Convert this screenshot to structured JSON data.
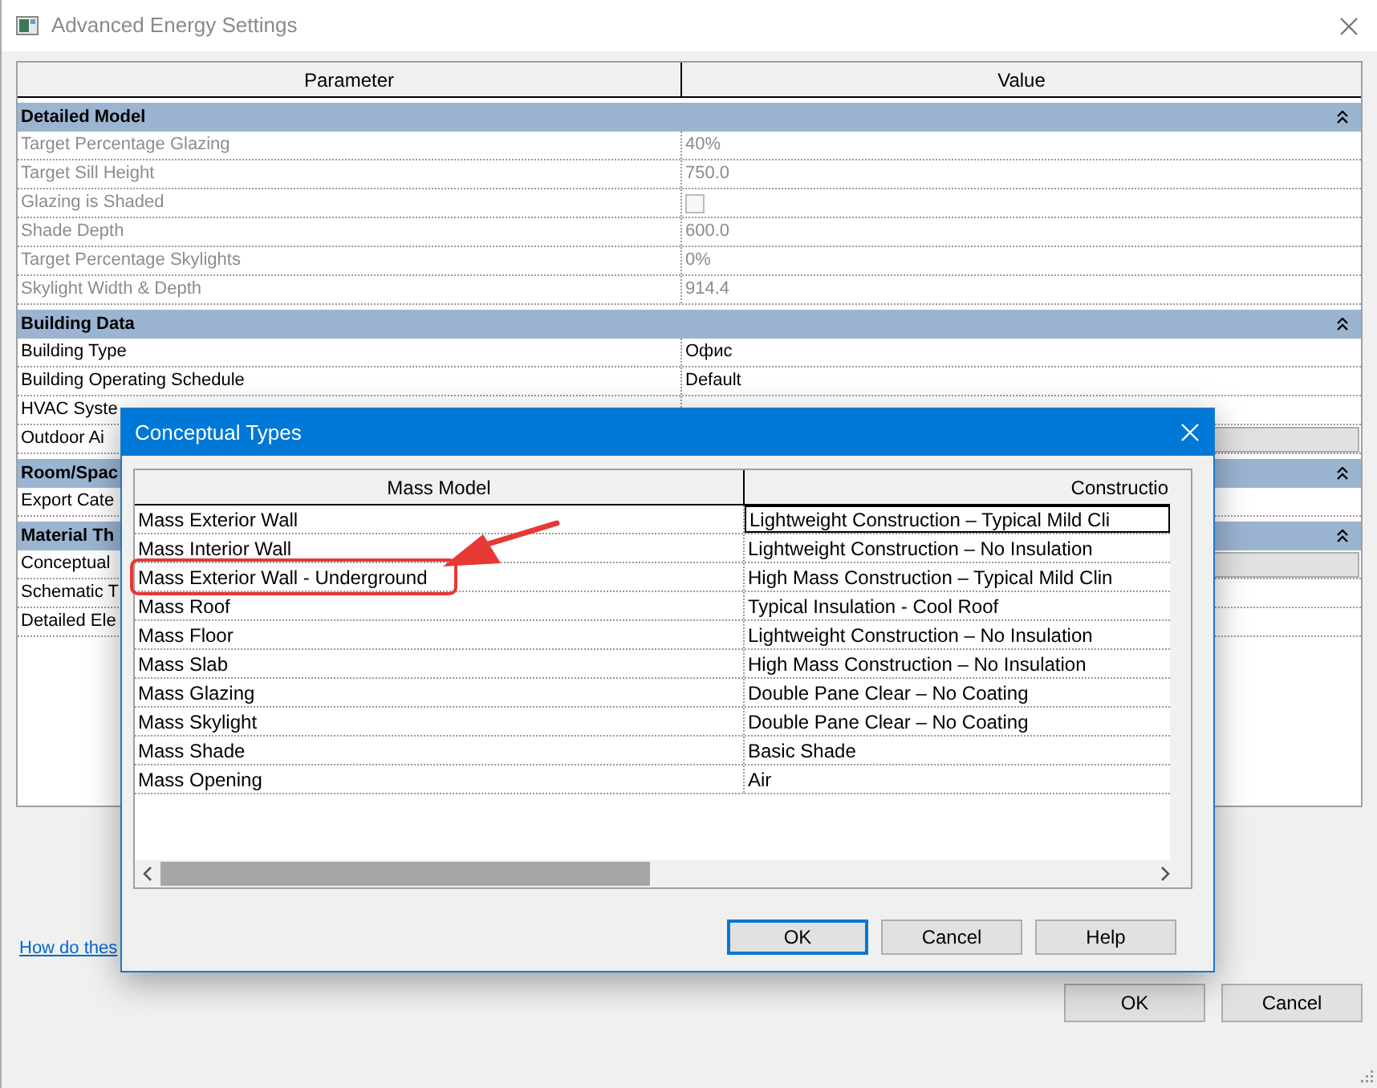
{
  "window": {
    "title": "Advanced Energy Settings"
  },
  "grid": {
    "columns": [
      "Parameter",
      "Value"
    ],
    "sections": [
      {
        "title": "Detailed Model",
        "expanded": true,
        "rows": [
          {
            "label": "Target Percentage Glazing",
            "kind": "text",
            "value": "40%",
            "disabled": true
          },
          {
            "label": "Target Sill Height",
            "kind": "text",
            "value": "750.0",
            "disabled": true
          },
          {
            "label": "Glazing is Shaded",
            "kind": "checkbox",
            "checked": false,
            "disabled": true
          },
          {
            "label": "Shade Depth",
            "kind": "text",
            "value": "600.0",
            "disabled": true
          },
          {
            "label": "Target Percentage Skylights",
            "kind": "text",
            "value": "0%",
            "disabled": true
          },
          {
            "label": "Skylight Width & Depth",
            "kind": "text",
            "value": "914.4",
            "disabled": true
          }
        ]
      },
      {
        "title": "Building Data",
        "expanded": true,
        "rows": [
          {
            "label": "Building Type",
            "kind": "text",
            "value": "Офис",
            "disabled": false
          },
          {
            "label": "Building Operating Schedule",
            "kind": "text",
            "value": "Default",
            "disabled": false
          },
          {
            "label": "HVAC Syste",
            "kind": "empty",
            "disabled": false
          },
          {
            "label": "Outdoor Ai",
            "kind": "dropdown",
            "disabled": false
          }
        ]
      },
      {
        "title": "Room/Spac",
        "expanded": true,
        "rows": [
          {
            "label": "Export Cate",
            "kind": "empty",
            "disabled": false
          }
        ]
      },
      {
        "title": "Material Th",
        "expanded": true,
        "rows": [
          {
            "label": "Conceptual",
            "kind": "dropdown",
            "disabled": false
          },
          {
            "label": "Schematic T",
            "kind": "empty",
            "disabled": false
          },
          {
            "label": "Detailed Ele",
            "kind": "empty",
            "disabled": false
          }
        ]
      }
    ]
  },
  "help_link": "How do thes",
  "buttons": [
    "OK",
    "Cancel"
  ],
  "dialog": {
    "title": "Conceptual Types",
    "columns": [
      "Mass Model",
      "Constructio"
    ],
    "rows": [
      {
        "model": "Mass Exterior Wall",
        "construction": "Lightweight Construction – Typical Mild Cli",
        "focused": true
      },
      {
        "model": "Mass Interior Wall",
        "construction": "Lightweight Construction – No Insulation",
        "focused": false
      },
      {
        "model": "Mass Exterior Wall - Underground",
        "construction": "High Mass Construction – Typical Mild Clin",
        "focused": false
      },
      {
        "model": "Mass Roof",
        "construction": "Typical Insulation - Cool Roof",
        "focused": false
      },
      {
        "model": "Mass Floor",
        "construction": "Lightweight Construction – No Insulation",
        "focused": false
      },
      {
        "model": "Mass Slab",
        "construction": "High Mass Construction – No Insulation",
        "focused": false
      },
      {
        "model": "Mass Glazing",
        "construction": "Double Pane Clear – No Coating",
        "focused": false
      },
      {
        "model": "Mass Skylight",
        "construction": "Double Pane Clear – No Coating",
        "focused": false
      },
      {
        "model": "Mass Shade",
        "construction": "Basic Shade",
        "focused": false
      },
      {
        "model": "Mass Opening",
        "construction": "Air",
        "focused": false
      }
    ],
    "buttons": [
      {
        "label": "OK",
        "default": true
      },
      {
        "label": "Cancel",
        "default": false
      },
      {
        "label": "Help",
        "default": false
      }
    ]
  }
}
